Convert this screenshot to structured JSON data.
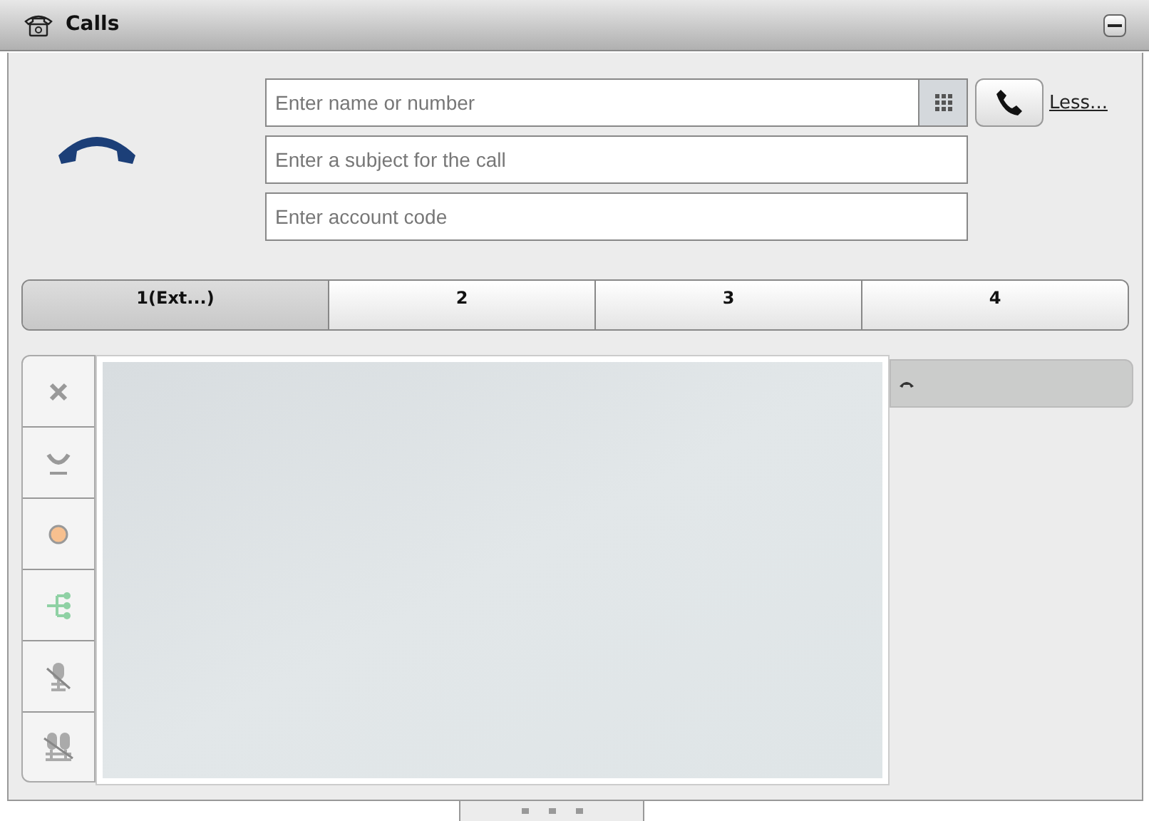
{
  "window": {
    "title": "Calls"
  },
  "fields": [
    {
      "placeholder": "Enter name or number",
      "kind": "dial"
    },
    {
      "placeholder": "Enter a subject for the call",
      "kind": "text"
    },
    {
      "placeholder": "Enter account code",
      "kind": "text"
    }
  ],
  "less_link": "Less...",
  "tabs": [
    {
      "label": "1(Ext...)",
      "selected": true
    },
    {
      "label": "2",
      "selected": false
    },
    {
      "label": "3",
      "selected": false
    },
    {
      "label": "4",
      "selected": false
    }
  ]
}
